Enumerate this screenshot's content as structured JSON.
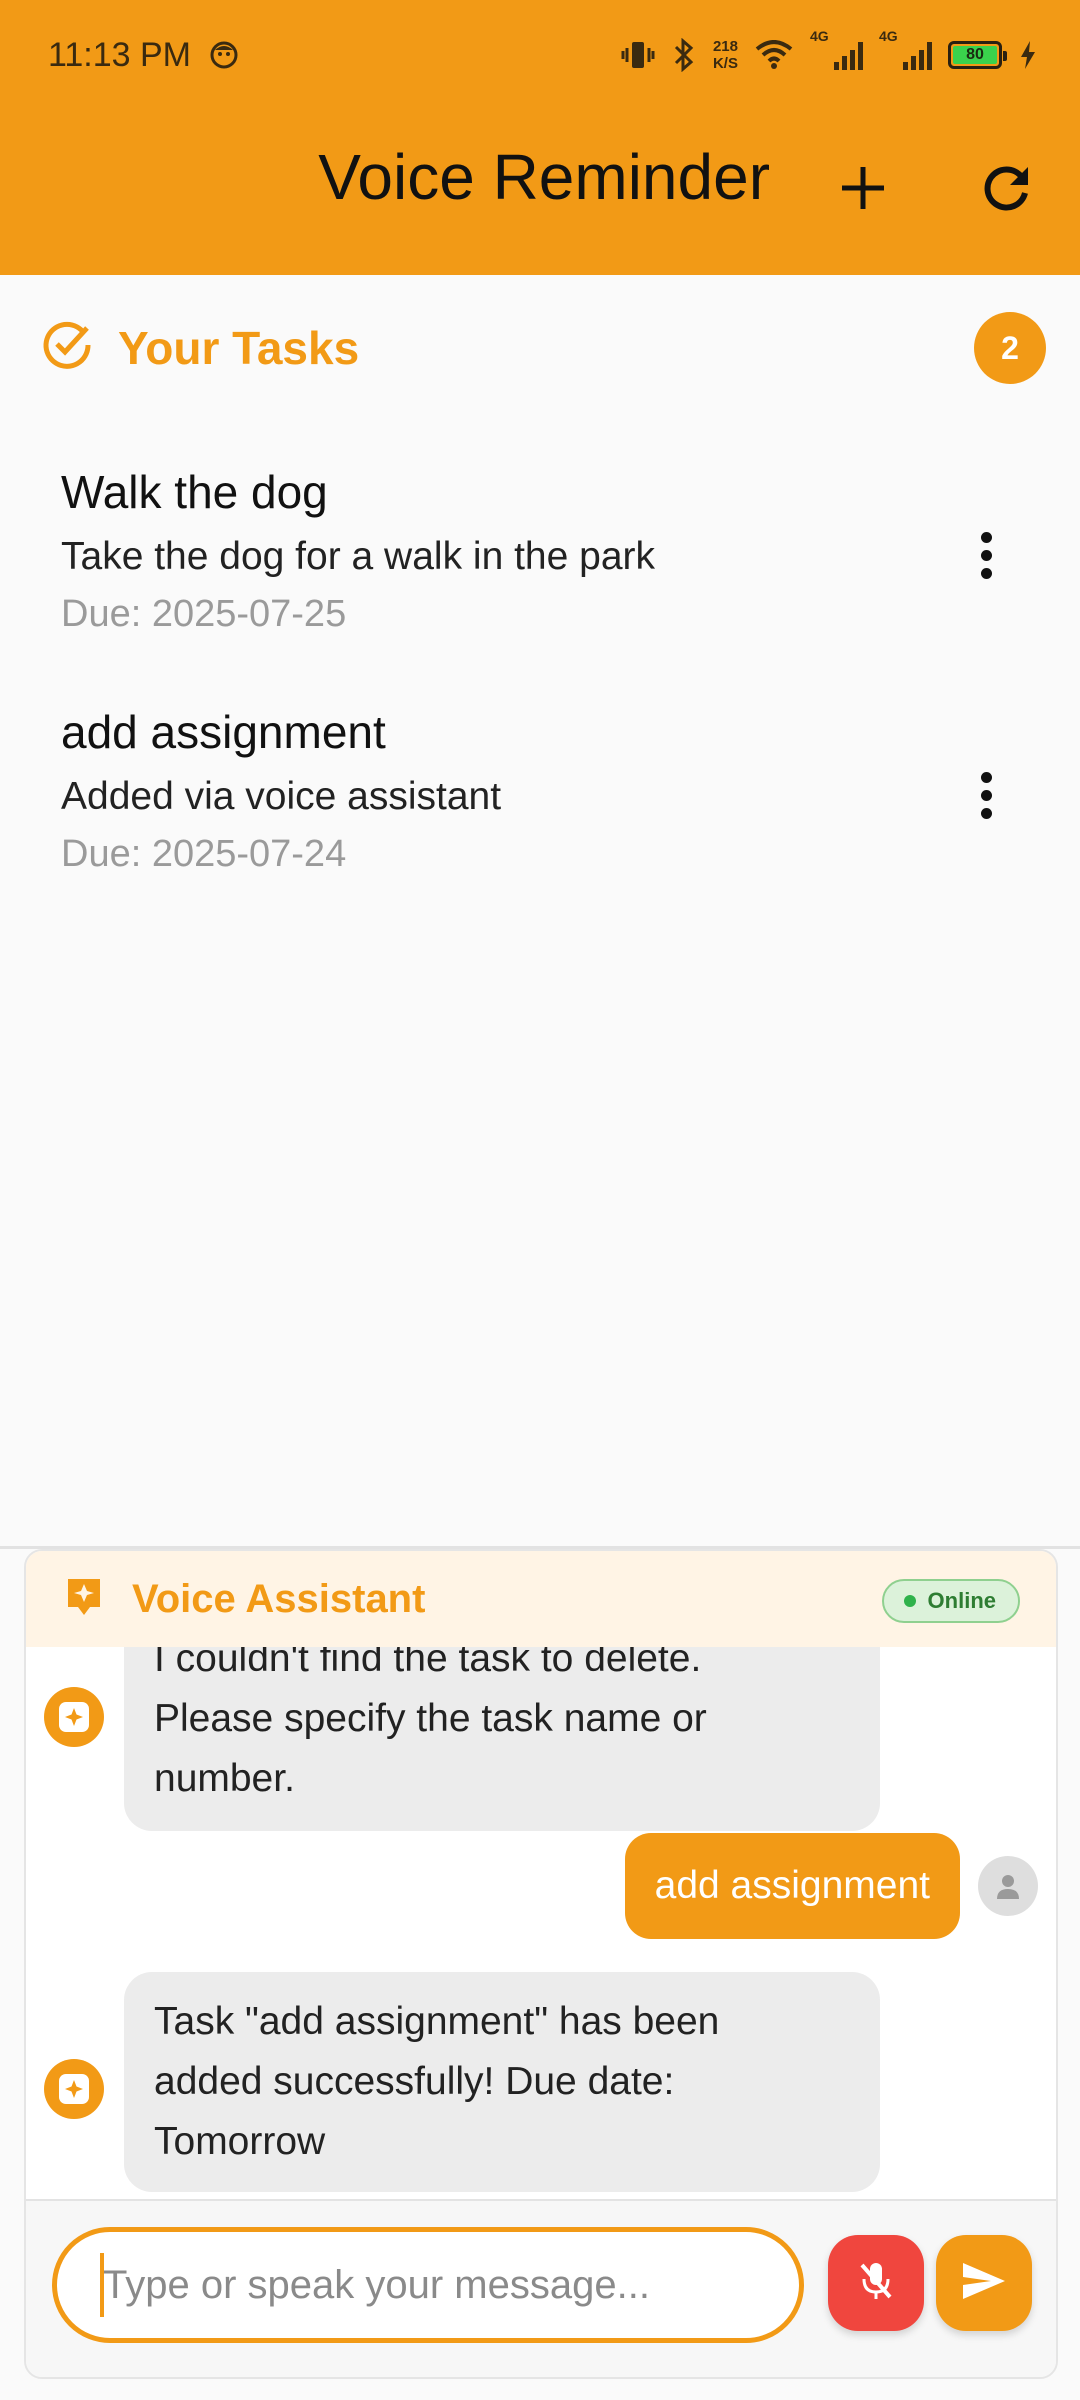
{
  "status_bar": {
    "time": "11:13 PM",
    "net_speed_value": "218",
    "net_speed_unit": "K/S",
    "signal_1_label": "4G",
    "signal_2_label": "4G",
    "battery_level": "80"
  },
  "app_bar": {
    "title": "Voice Reminder",
    "add_icon": "plus-icon",
    "refresh_icon": "refresh-icon"
  },
  "tasks": {
    "header": "Your Tasks",
    "count": "2",
    "items": [
      {
        "title": "Walk the dog",
        "description": "Take the dog for a walk in the park",
        "due": "Due: 2025-07-25"
      },
      {
        "title": "add assignment",
        "description": "Added via voice assistant",
        "due": "Due: 2025-07-24"
      }
    ]
  },
  "assistant": {
    "title": "Voice Assistant",
    "status": "Online",
    "messages": [
      {
        "from": "bot",
        "lines": [
          "I couldn't find the task to delete.",
          "Please specify the task name or",
          "number."
        ]
      },
      {
        "from": "user",
        "text": "add assignment"
      },
      {
        "from": "bot",
        "lines": [
          "Task \"add assignment\" has been",
          "added successfully! Due date:",
          "Tomorrow"
        ]
      }
    ],
    "input_placeholder": "Type or speak your message...",
    "input_value": ""
  },
  "colors": {
    "accent": "#f29a16",
    "mic_button": "#f0463e",
    "online_green": "#2fb24b",
    "panel_header_bg": "#fff4e5"
  }
}
